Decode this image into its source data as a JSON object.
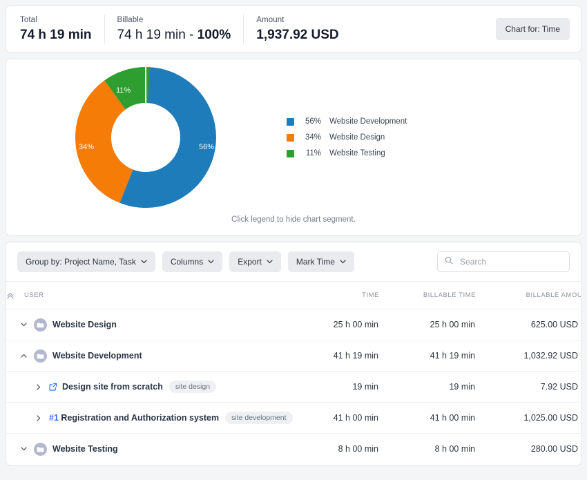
{
  "summary": {
    "metrics": [
      {
        "label": "Total",
        "value": "74 h 19 min"
      },
      {
        "label": "Billable",
        "value_plain": "74 h 19 min - ",
        "value_bold": "100%"
      },
      {
        "label": "Amount",
        "value": "1,937.92 USD"
      }
    ],
    "chart_for_button": "Chart for: Time"
  },
  "chart_card": {
    "hint": "Click legend to hide chart segment."
  },
  "chart_data": {
    "type": "pie",
    "variant": "donut",
    "title": "",
    "categories": [
      "Website Development",
      "Website Design",
      "Website Testing"
    ],
    "values": [
      56,
      34,
      11
    ],
    "value_labels": [
      "56%",
      "34%",
      "11%"
    ],
    "colors": [
      "#1f7cba",
      "#f57c07",
      "#2d9e2f"
    ],
    "legend": [
      {
        "pct": "56%",
        "name": "Website Development",
        "color": "#1f7cba"
      },
      {
        "pct": "34%",
        "name": "Website Design",
        "color": "#f57c07"
      },
      {
        "pct": "11%",
        "name": "Website Testing",
        "color": "#2d9e2f"
      }
    ],
    "legend_position": "right",
    "grid": false,
    "units": "percent_of_time"
  },
  "toolbar": {
    "group_by": "Group by: Project Name, Task",
    "columns": "Columns",
    "export": "Export",
    "mark_time": "Mark Time",
    "search_placeholder": "Search",
    "search_value": ""
  },
  "table": {
    "headers": {
      "user": "USER",
      "time": "TIME",
      "billable_time": "BILLABLE TIME",
      "billable_amount": "BILLABLE AMOUNT"
    },
    "rows": [
      {
        "kind": "project",
        "expanded": false,
        "chevron": "chevron-down",
        "title": "Website Design",
        "prefix": "",
        "tag": "",
        "time": "25 h 00 min",
        "billable_time": "25 h 00 min",
        "billable_amount": "625.00 USD"
      },
      {
        "kind": "project",
        "expanded": true,
        "chevron": "chevron-up",
        "title": "Website Development",
        "prefix": "",
        "tag": "",
        "time": "41 h 19 min",
        "billable_time": "41 h 19 min",
        "billable_amount": "1,032.92 USD"
      },
      {
        "kind": "task",
        "expanded": false,
        "chevron": "chevron-right",
        "title": "Design site from scratch",
        "prefix": "",
        "tag": "site design",
        "time": "19 min",
        "billable_time": "19 min",
        "billable_amount": "7.92 USD"
      },
      {
        "kind": "task",
        "expanded": false,
        "chevron": "chevron-right",
        "title": "Registration and Authorization system",
        "prefix": "#1",
        "tag": "site development",
        "time": "41 h 00 min",
        "billable_time": "41 h 00 min",
        "billable_amount": "1,025.00 USD"
      },
      {
        "kind": "project",
        "expanded": false,
        "chevron": "chevron-down",
        "title": "Website Testing",
        "prefix": "",
        "tag": "",
        "time": "8 h 00 min",
        "billable_time": "8 h 00 min",
        "billable_amount": "280.00 USD"
      }
    ]
  }
}
